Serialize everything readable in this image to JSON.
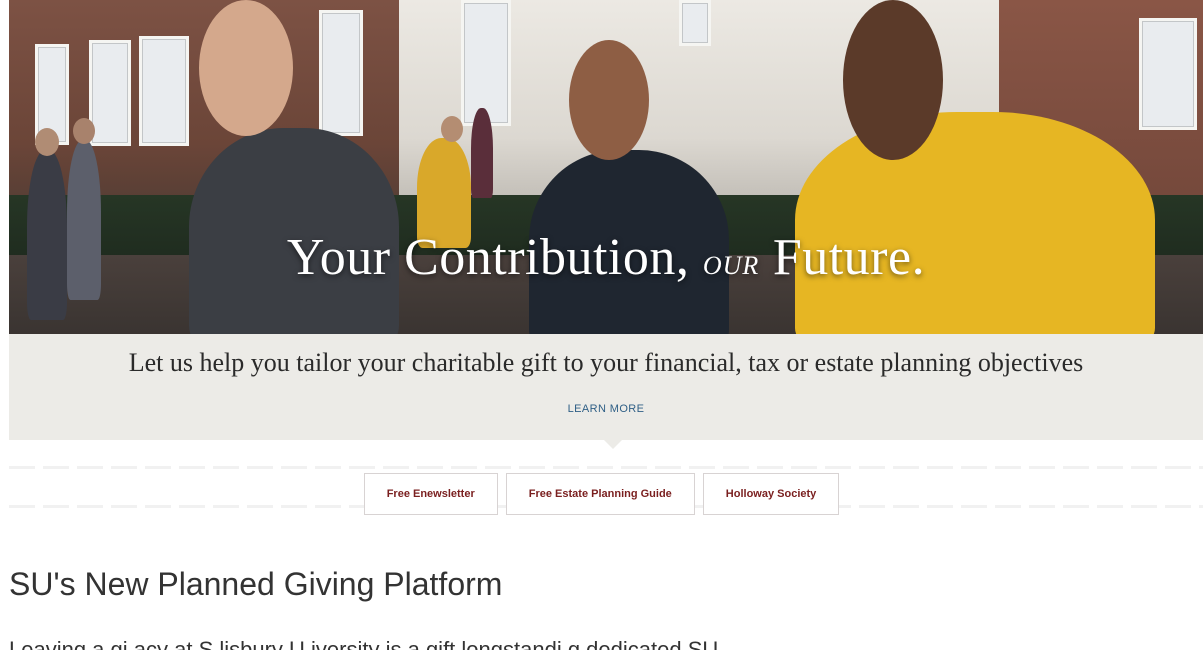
{
  "hero": {
    "title_part1": "Your Contribution,",
    "title_small": "our",
    "title_part2": "Future."
  },
  "banner": {
    "tagline": "Let us help you tailor your charitable gift to your financial, tax or estate planning objectives",
    "learn_more_label": "LEARN MORE"
  },
  "buttons": [
    {
      "label": "Free Enewsletter"
    },
    {
      "label": "Free Estate Planning Guide"
    },
    {
      "label": "Holloway Society"
    }
  ],
  "content": {
    "section_title": "SU's New Planned Giving Platform",
    "intro": "Leaving a gi  acy at S lisbury U iversity is a gift longstandi  g dedicated  SU"
  },
  "colors": {
    "banner_bg": "#ecebe7",
    "button_text": "#7a1f1f",
    "link": "#2f5f86"
  }
}
